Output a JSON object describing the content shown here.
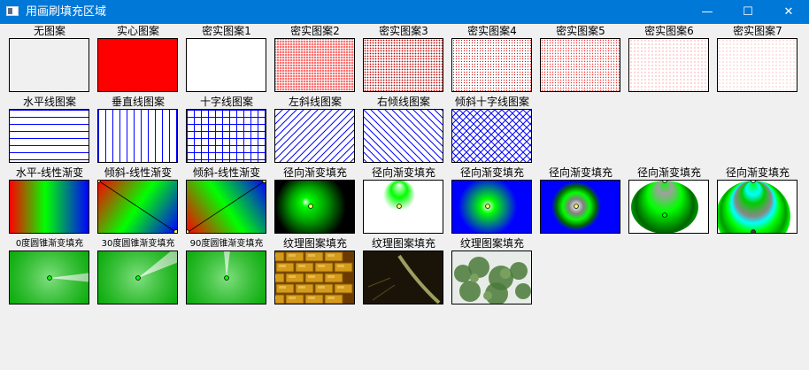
{
  "window": {
    "title": "用画刷填充区域",
    "minimize_glyph": "—",
    "maximize_glyph": "☐",
    "close_glyph": "✕"
  },
  "rows": [
    {
      "cells": [
        {
          "label": "无图案",
          "type": "none"
        },
        {
          "label": "实心图案",
          "type": "solid",
          "color": "#ff0000"
        },
        {
          "label": "密实图案1",
          "type": "dense",
          "level": 1
        },
        {
          "label": "密实图案2",
          "type": "dense",
          "level": 2
        },
        {
          "label": "密实图案3",
          "type": "dense",
          "level": 3
        },
        {
          "label": "密实图案4",
          "type": "dense",
          "level": 4
        },
        {
          "label": "密实图案5",
          "type": "dense",
          "level": 5
        },
        {
          "label": "密实图案6",
          "type": "dense",
          "level": 6
        },
        {
          "label": "密实图案7",
          "type": "dense",
          "level": 7
        }
      ]
    },
    {
      "cells": [
        {
          "label": "水平线图案",
          "type": "hatch",
          "style": "horizontal"
        },
        {
          "label": "垂直线图案",
          "type": "hatch",
          "style": "vertical"
        },
        {
          "label": "十字线图案",
          "type": "hatch",
          "style": "cross"
        },
        {
          "label": "左斜线图案",
          "type": "hatch",
          "style": "fdiagonal"
        },
        {
          "label": "右倾线图案",
          "type": "hatch",
          "style": "bdiagonal"
        },
        {
          "label": "倾斜十字线图案",
          "type": "hatch",
          "style": "diagcross"
        }
      ]
    },
    {
      "cells": [
        {
          "label": "水平-线性渐变",
          "type": "linear-h"
        },
        {
          "label": "倾斜-线性渐变",
          "type": "linear-diag1"
        },
        {
          "label": "倾斜-线性渐变",
          "type": "linear-diag2"
        },
        {
          "label": "径向渐变填充",
          "type": "radial1"
        },
        {
          "label": "径向渐变填充",
          "type": "radial2"
        },
        {
          "label": "径向渐变填充",
          "type": "radial3"
        },
        {
          "label": "径向渐变填充",
          "type": "radial4"
        },
        {
          "label": "径向渐变填充",
          "type": "radial5"
        },
        {
          "label": "径向渐变填充",
          "type": "radial6"
        }
      ]
    },
    {
      "cells": [
        {
          "label": "0度圆锥渐变填充",
          "type": "conical",
          "angle": 0,
          "small": true
        },
        {
          "label": "30度圆锥渐变填充",
          "type": "conical",
          "angle": 30,
          "small": true
        },
        {
          "label": "90度圆锥渐变填充",
          "type": "conical",
          "angle": 90,
          "small": true
        },
        {
          "label": "纹理图案填充",
          "type": "tex-bricks"
        },
        {
          "label": "纹理图案填充",
          "type": "tex-dark"
        },
        {
          "label": "纹理图案填充",
          "type": "tex-plants"
        }
      ]
    }
  ],
  "colors": {
    "titlebar": "#0078d7",
    "pattern_red": "#ff0000",
    "hatch_blue": "#0000ff",
    "grad_green": "#00ff00",
    "grad_dark_green": "#009900"
  }
}
